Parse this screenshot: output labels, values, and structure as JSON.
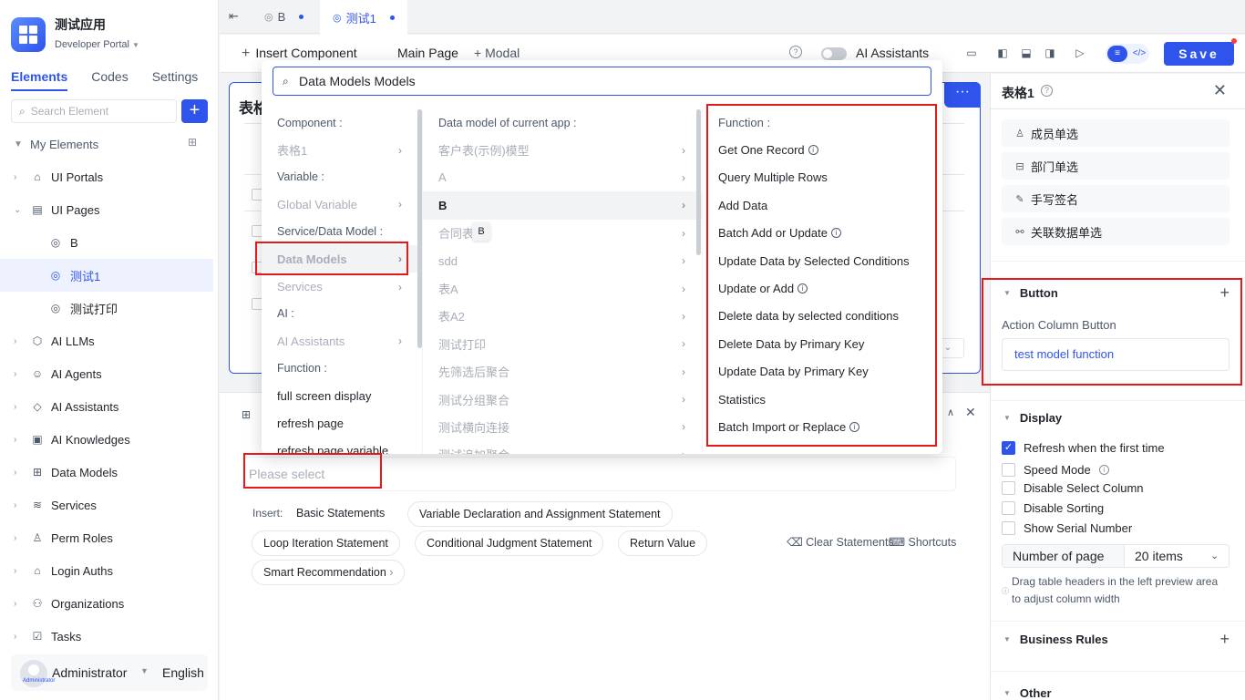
{
  "app": {
    "name": "测试应用",
    "portal": "Developer Portal"
  },
  "sidebar": {
    "tabs": [
      "Elements",
      "Codes",
      "Settings"
    ],
    "search_placeholder": "Search Element",
    "tree_header": "My Elements",
    "items": [
      {
        "label": "UI Portals",
        "icon": "portal-icon"
      },
      {
        "label": "UI Pages",
        "icon": "page-icon",
        "expanded": true
      },
      {
        "label": "B",
        "icon": "page-item-icon",
        "sub": true
      },
      {
        "label": "测试1",
        "icon": "page-item-icon",
        "sub": true,
        "selected": true
      },
      {
        "label": "测试打印",
        "icon": "page-item-icon",
        "sub": true
      },
      {
        "label": "AI LLMs",
        "icon": "llm-icon"
      },
      {
        "label": "AI Agents",
        "icon": "agent-icon"
      },
      {
        "label": "AI Assistants",
        "icon": "assistant-icon"
      },
      {
        "label": "AI Knowledges",
        "icon": "knowledge-icon"
      },
      {
        "label": "Data Models",
        "icon": "table-icon"
      },
      {
        "label": "Services",
        "icon": "service-icon"
      },
      {
        "label": "Perm Roles",
        "icon": "role-icon"
      },
      {
        "label": "Login Auths",
        "icon": "auth-icon"
      },
      {
        "label": "Organizations",
        "icon": "org-icon"
      },
      {
        "label": "Tasks",
        "icon": "task-icon"
      }
    ],
    "user": {
      "name": "Administrator",
      "avatar_caption": "Administrator",
      "language": "English"
    }
  },
  "tabs": [
    {
      "label": "B",
      "unsaved": true
    },
    {
      "label": "测试1",
      "unsaved": true,
      "active": true
    }
  ],
  "toolbar": {
    "insert_component": "Insert Component",
    "main_page": "Main Page",
    "modal": "Modal",
    "ai_assistants": "AI Assistants",
    "save": "Save"
  },
  "canvas": {
    "table_title": "表格"
  },
  "popup": {
    "search_value": "Data Models Models",
    "col1": [
      {
        "type": "group",
        "label": "Component :"
      },
      {
        "type": "item",
        "label": "表格1",
        "dim": true,
        "chevron": true
      },
      {
        "type": "group",
        "label": "Variable :"
      },
      {
        "type": "item",
        "label": "Global Variable",
        "dim": true,
        "chevron": true
      },
      {
        "type": "group",
        "label": "Service/Data Model :"
      },
      {
        "type": "item",
        "label": "Data Models",
        "dim": true,
        "chevron": true,
        "highlight": true
      },
      {
        "type": "item",
        "label": "Services",
        "dim": true,
        "chevron": true
      },
      {
        "type": "group",
        "label": "AI :"
      },
      {
        "type": "item",
        "label": "AI Assistants",
        "dim": true,
        "chevron": true
      },
      {
        "type": "group",
        "label": "Function :"
      },
      {
        "type": "item",
        "label": "full screen display"
      },
      {
        "type": "item",
        "label": "refresh page"
      },
      {
        "type": "item",
        "label": "refresh page variable"
      }
    ],
    "col2_header": "Data model of current app :",
    "col2": [
      {
        "label": "客户表(示例)模型",
        "dim": true
      },
      {
        "label": "A",
        "dim": true
      },
      {
        "label": "B",
        "active": true
      },
      {
        "label": "合同表",
        "dim": true
      },
      {
        "label": "sdd",
        "dim": true
      },
      {
        "label": "表A",
        "dim": true
      },
      {
        "label": "表A2",
        "dim": true
      },
      {
        "label": "测试打印",
        "dim": true
      },
      {
        "label": "先筛选后聚合",
        "dim": true
      },
      {
        "label": "测试分组聚合",
        "dim": true
      },
      {
        "label": "测试横向连接",
        "dim": true
      },
      {
        "label": "测试追加聚合",
        "dim": true
      }
    ],
    "tooltip": "B",
    "col3_header": "Function :",
    "col3": [
      {
        "label": "Get One Record",
        "info": true
      },
      {
        "label": "Query Multiple Rows"
      },
      {
        "label": "Add Data"
      },
      {
        "label": "Batch Add or Update",
        "info": true
      },
      {
        "label": "Update Data by Selected Conditions"
      },
      {
        "label": "Update or Add",
        "info": true
      },
      {
        "label": "Delete data by selected conditions"
      },
      {
        "label": "Delete Data by Primary Key"
      },
      {
        "label": "Update Data by Primary Key"
      },
      {
        "label": "Statistics"
      },
      {
        "label": "Batch Import or Replace",
        "info": true
      }
    ]
  },
  "code_panel": {
    "select_placeholder": "Please select",
    "insert_label": "Insert:",
    "statements": [
      "Basic Statements",
      "Variable Declaration and Assignment Statement",
      "Loop Iteration Statement",
      "Conditional Judgment Statement",
      "Return Value",
      "Smart Recommendation"
    ],
    "clear_statements": "Clear Statements",
    "shortcuts": "Shortcuts"
  },
  "props": {
    "title": "表格1",
    "components": [
      {
        "label": "成员单选",
        "icon": "member-icon"
      },
      {
        "label": "部门单选",
        "icon": "department-icon"
      },
      {
        "label": "手写签名",
        "icon": "signature-icon"
      },
      {
        "label": "关联数据单选",
        "icon": "link-data-icon"
      }
    ],
    "button_section": "Button",
    "action_column_label": "Action Column Button",
    "action_column_value": "test model function",
    "display_section": "Display",
    "checks": [
      {
        "label": "Refresh when the first time",
        "checked": true
      },
      {
        "label": "Speed Mode",
        "checked": false,
        "info": true
      },
      {
        "label": "Disable Select Column",
        "checked": false
      },
      {
        "label": "Disable Sorting",
        "checked": false
      },
      {
        "label": "Show Serial Number",
        "checked": false
      }
    ],
    "page_size_label": "Number of page",
    "page_size_value": "20 items",
    "drag_hint": "Drag table headers in the left preview area to adjust column width",
    "business_rules_section": "Business Rules",
    "other_section": "Other"
  },
  "colors": {
    "accent": "#2f54eb",
    "annotation_red": "#e81818"
  }
}
